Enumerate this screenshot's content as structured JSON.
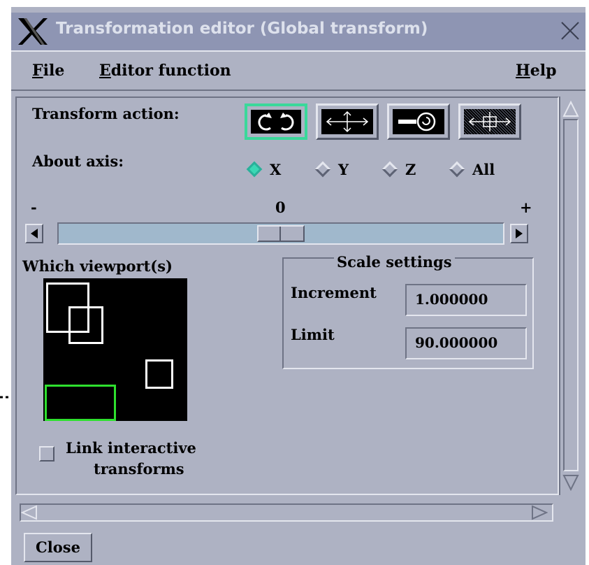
{
  "window": {
    "title": "Transformation editor (Global transform)"
  },
  "menu": {
    "file": "File",
    "editor_function": "Editor function",
    "help": "Help"
  },
  "transform_action": {
    "label": "Transform action:",
    "buttons": [
      {
        "icon": "rotate-icon",
        "selected": true
      },
      {
        "icon": "translate-icon",
        "selected": false
      },
      {
        "icon": "scale-icon",
        "selected": false
      },
      {
        "icon": "move-all-icon",
        "selected": false
      }
    ]
  },
  "about_axis": {
    "label": "About axis:",
    "options": [
      "X",
      "Y",
      "Z",
      "All"
    ],
    "selected": "X"
  },
  "slider": {
    "minus": "-",
    "zero": "0",
    "plus": "+"
  },
  "viewports": {
    "label": "Which viewport(s)"
  },
  "scale_settings": {
    "title": "Scale settings",
    "increment_label": "Increment",
    "increment_value": "1.000000",
    "limit_label": "Limit",
    "limit_value": "90.000000"
  },
  "link": {
    "line1": "Link interactive",
    "line2": "transforms",
    "checked": false
  },
  "buttons": {
    "close": "Close"
  },
  "colors": {
    "window_bg": "#aeb2c3",
    "title_bg": "#8e95b3",
    "accent": "#3ad8b4",
    "selected_viewport": "#2ee02e",
    "slider_trough": "#a0b8cc"
  }
}
